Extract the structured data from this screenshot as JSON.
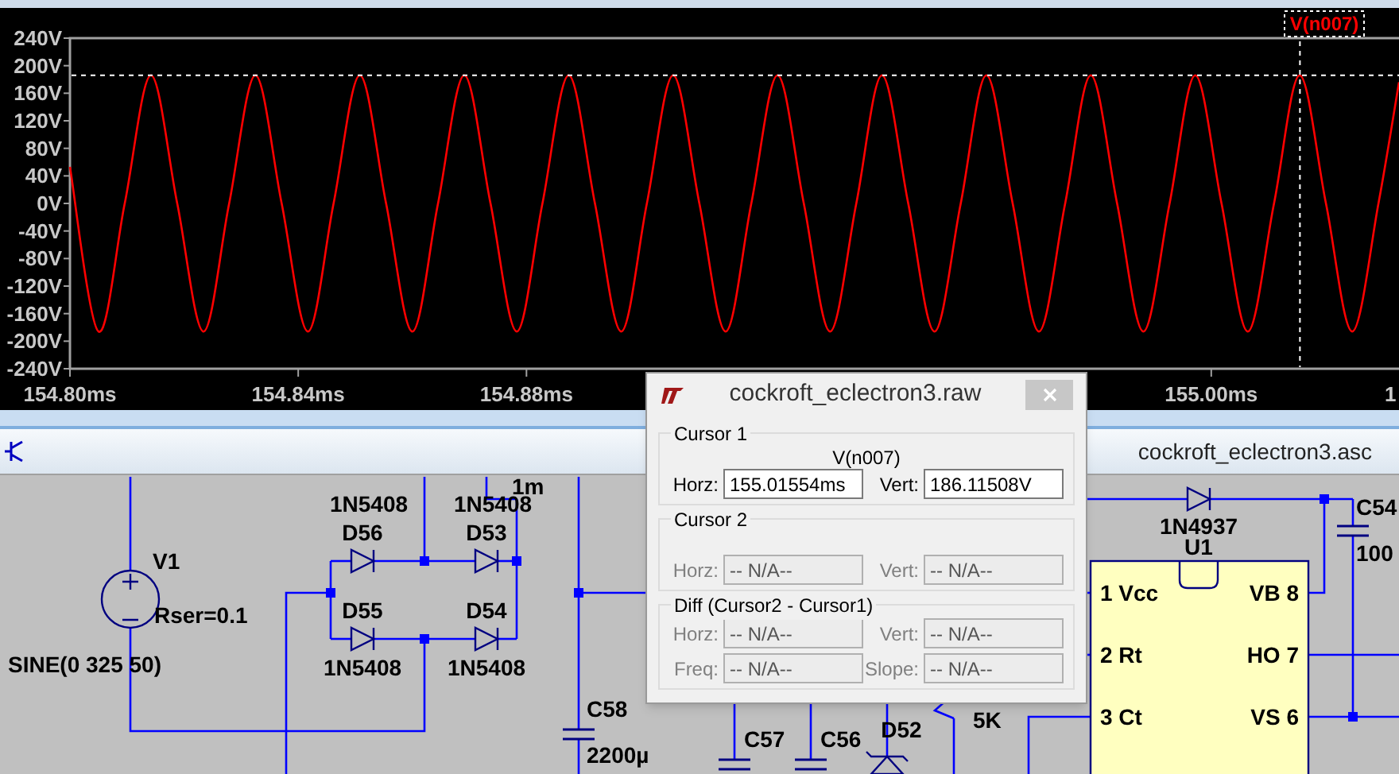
{
  "plot": {
    "chart_data": {
      "type": "line",
      "x": [
        154.8,
        154.805,
        154.8096,
        154.8142,
        154.8188,
        154.8234,
        154.8279,
        154.8325,
        154.8371,
        154.8417,
        154.8462,
        154.8508,
        154.8554,
        154.86,
        154.8645,
        154.8691,
        154.8737,
        154.8783,
        154.8828,
        154.8874,
        154.892,
        154.8966,
        154.9011,
        154.9057,
        154.9103,
        154.9149,
        154.9194,
        154.924,
        154.9286,
        154.9332,
        154.9378,
        154.9423,
        154.9469,
        154.9515,
        154.9561,
        154.9606,
        154.9652,
        154.9698,
        154.9744,
        154.9789,
        154.9835,
        154.9881,
        154.9927,
        154.9972,
        155.0018,
        155.0064,
        155.011,
        155.0155,
        155.0201,
        155.0247,
        155.0293,
        155.0329
      ],
      "series": [
        {
          "name": "V(n007)",
          "color": "#ff0000",
          "values": [
            53,
            -186,
            0,
            186,
            0,
            -186,
            0,
            186,
            0,
            -186,
            0,
            186,
            0,
            -186,
            0,
            186,
            0,
            -186,
            0,
            186,
            0,
            -186,
            0,
            186,
            0,
            -186,
            0,
            186,
            0,
            -186,
            0,
            186,
            0,
            -186,
            0,
            186,
            0,
            -186,
            0,
            186,
            0,
            -186,
            0,
            186,
            0,
            -186,
            0,
            186,
            0,
            -186,
            0,
            176
          ]
        }
      ],
      "xlim": [
        154.8,
        155.0329
      ],
      "ylim": [
        -240,
        240
      ],
      "yticks": [
        {
          "value": 240,
          "label": "240V"
        },
        {
          "value": 200,
          "label": "200V"
        },
        {
          "value": 160,
          "label": "160V"
        },
        {
          "value": 120,
          "label": "120V"
        },
        {
          "value": 80,
          "label": "80V"
        },
        {
          "value": 40,
          "label": "40V"
        },
        {
          "value": 0,
          "label": "0V"
        },
        {
          "value": -40,
          "label": "-40V"
        },
        {
          "value": -80,
          "label": "-80V"
        },
        {
          "value": -120,
          "label": "-120V"
        },
        {
          "value": -160,
          "label": "-160V"
        },
        {
          "value": -200,
          "label": "-200V"
        },
        {
          "value": -240,
          "label": "-240V"
        }
      ],
      "xticks": [
        {
          "value": 154.8,
          "label": "154.80ms"
        },
        {
          "value": 154.84,
          "label": "154.84ms"
        },
        {
          "value": 154.88,
          "label": "154.88ms"
        },
        {
          "value": 155.0,
          "label": "155.00ms"
        }
      ],
      "ref_lines": [
        {
          "axis": "y",
          "value": 186.11508
        },
        {
          "axis": "x",
          "value": 155.01554
        }
      ]
    },
    "cut_tick_label": "1"
  },
  "schematic_window": {
    "title": "cockroft_eclectron3.asc"
  },
  "schematic": {
    "source": {
      "name": "V1",
      "series_resistance": "Rser=0.1",
      "value": "SINE(0 325 50)"
    },
    "bridge_diodes": [
      {
        "name": "D56",
        "part": "1N5408"
      },
      {
        "name": "D53",
        "part": "1N5408"
      },
      {
        "name": "D55",
        "part": "1N5408"
      },
      {
        "name": "D54",
        "part": "1N5408"
      }
    ],
    "inductor_value": "1m",
    "capacitors": [
      {
        "name": "C58",
        "value": "2200µ"
      },
      {
        "name": "C57"
      },
      {
        "name": "C56"
      },
      {
        "name": "C54",
        "value": "100"
      }
    ],
    "zener": {
      "name": "D52"
    },
    "resistor_value": "5K",
    "bootstrap_diode": {
      "part": "1N4937"
    },
    "ic": {
      "name": "U1",
      "pins_left": [
        "1 Vcc",
        "2 Rt",
        "3 Ct"
      ],
      "pins_right": [
        "VB 8",
        "HO 7",
        "VS 6"
      ]
    }
  },
  "cursor_dialog": {
    "title": "cockroft_eclectron3.raw",
    "groups": [
      {
        "kind": "cursor",
        "title": "Cursor 1",
        "trace": "V(n007)",
        "fields": [
          {
            "label": "Horz:",
            "value": "155.01554ms",
            "disabled": false
          },
          {
            "label": "Vert:",
            "value": "186.11508V",
            "disabled": false
          }
        ]
      },
      {
        "kind": "cursor",
        "title": "Cursor 2",
        "fields": [
          {
            "label": "Horz:",
            "value": "-- N/A--",
            "disabled": true
          },
          {
            "label": "Vert:",
            "value": "-- N/A--",
            "disabled": true
          }
        ]
      },
      {
        "kind": "diff",
        "title": "Diff (Cursor2 - Cursor1)",
        "fields": [
          {
            "label": "Horz:",
            "value": "-- N/A--",
            "disabled": true
          },
          {
            "label": "Vert:",
            "value": "-- N/A--",
            "disabled": true
          },
          {
            "label": "Freq:",
            "value": "-- N/A--",
            "disabled": true
          },
          {
            "label": "Slope:",
            "value": "-- N/A--",
            "disabled": true
          }
        ]
      }
    ]
  }
}
